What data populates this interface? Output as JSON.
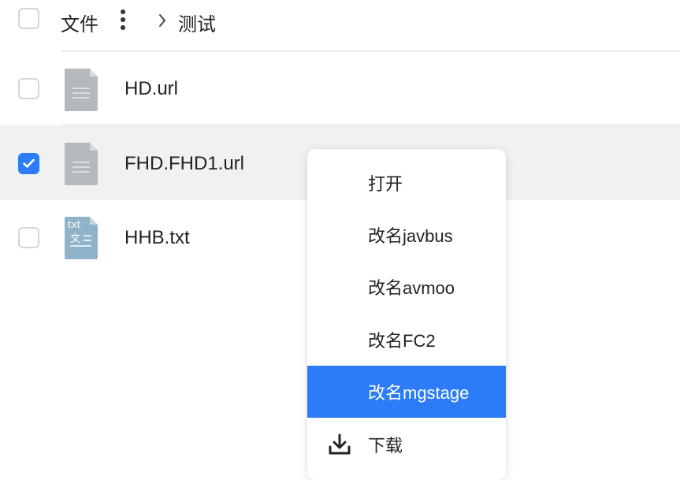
{
  "header": {
    "select_all_checked": false,
    "title": "文件",
    "more_icon": "kebab-vertical-icon",
    "breadcrumb_chevron_icon": "chevron-right-icon",
    "breadcrumb_current": "测试"
  },
  "files": [
    {
      "name": "HD.url",
      "icon": "document-icon",
      "checked": false
    },
    {
      "name": "FHD.FHD1.url",
      "icon": "document-icon",
      "checked": true
    },
    {
      "name": "HHB.txt",
      "icon": "txt-file-icon",
      "icon_label": "txt",
      "icon_glyph": "文",
      "checked": false
    }
  ],
  "context_menu": {
    "items": [
      {
        "label": "打开"
      },
      {
        "label": "改名javbus"
      },
      {
        "label": "改名avmoo"
      },
      {
        "label": "改名FC2"
      },
      {
        "label": "改名mgstage",
        "highlighted": true
      },
      {
        "label": "下载",
        "icon": "download-icon"
      }
    ]
  },
  "colors": {
    "accent": "#2b7cf6",
    "selected_row": "#f0f1f3",
    "document_icon": "#b4b9bd",
    "txt_icon": "#8fb3c9"
  }
}
